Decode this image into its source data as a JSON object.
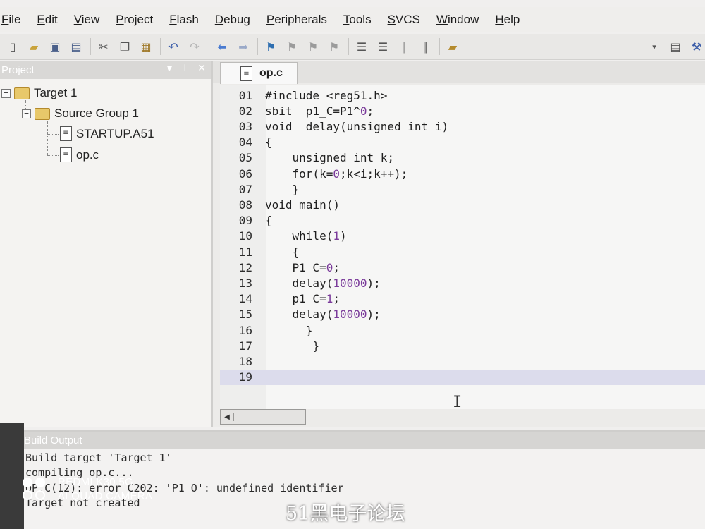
{
  "menu": {
    "items": [
      "File",
      "Edit",
      "View",
      "Project",
      "Flash",
      "Debug",
      "Peripherals",
      "Tools",
      "SVCS",
      "Window",
      "Help"
    ]
  },
  "toolbar": {
    "icons": [
      "new-file-icon",
      "open-folder-icon",
      "save-icon",
      "save-all-icon",
      "cut-icon",
      "copy-icon",
      "paste-icon",
      "undo-icon",
      "redo-icon",
      "nav-back-icon",
      "nav-forward-icon",
      "bookmark-icon",
      "bookmark-prev-icon",
      "bookmark-next-icon",
      "bookmark-clear-icon",
      "indent-icon",
      "unindent-icon",
      "comment-icon",
      "uncomment-icon",
      "find-in-files-icon"
    ]
  },
  "project_panel": {
    "title": "Project",
    "tree": {
      "target": "Target 1",
      "group": "Source Group 1",
      "files": [
        "STARTUP.A51",
        "op.c"
      ]
    }
  },
  "editor": {
    "tab_label": "op.c",
    "lines": [
      {
        "n": "01",
        "text": "#include <reg51.h>"
      },
      {
        "n": "02",
        "text": "sbit  p1_C=P1^0;"
      },
      {
        "n": "03",
        "text": "void  delay(unsigned int i)"
      },
      {
        "n": "04",
        "text": "{"
      },
      {
        "n": "05",
        "text": "    unsigned int k;"
      },
      {
        "n": "06",
        "text": "    for(k=0;k<i;k++);"
      },
      {
        "n": "07",
        "text": "    }"
      },
      {
        "n": "08",
        "text": "void main()"
      },
      {
        "n": "09",
        "text": "{"
      },
      {
        "n": "10",
        "text": "    while(1)"
      },
      {
        "n": "11",
        "text": "    {"
      },
      {
        "n": "12",
        "text": "    P1_C=0;"
      },
      {
        "n": "13",
        "text": "    delay(10000);"
      },
      {
        "n": "14",
        "text": "    p1_C=1;"
      },
      {
        "n": "15",
        "text": "    delay(10000);"
      },
      {
        "n": "16",
        "text": "      }"
      },
      {
        "n": "17",
        "text": "       }"
      },
      {
        "n": "18",
        "text": ""
      },
      {
        "n": "19",
        "text": ""
      }
    ],
    "current_line": "19"
  },
  "build_output": {
    "title": "Build Output",
    "lines": [
      "Build target 'Target 1'",
      "compiling op.c...",
      "OP.C(12): error C202: 'P1_O': undefined identifier",
      "Target not created"
    ]
  },
  "overlay": {
    "camera_line1": "REDMI K30 5G",
    "camera_line2": "AI QUAD CAMERA",
    "watermark": "51黑电子论坛"
  },
  "colors": {
    "accent_number": "#7a3a9a",
    "current_line_bg": "#dcdcec",
    "panel_header": "#d9d8d6"
  }
}
